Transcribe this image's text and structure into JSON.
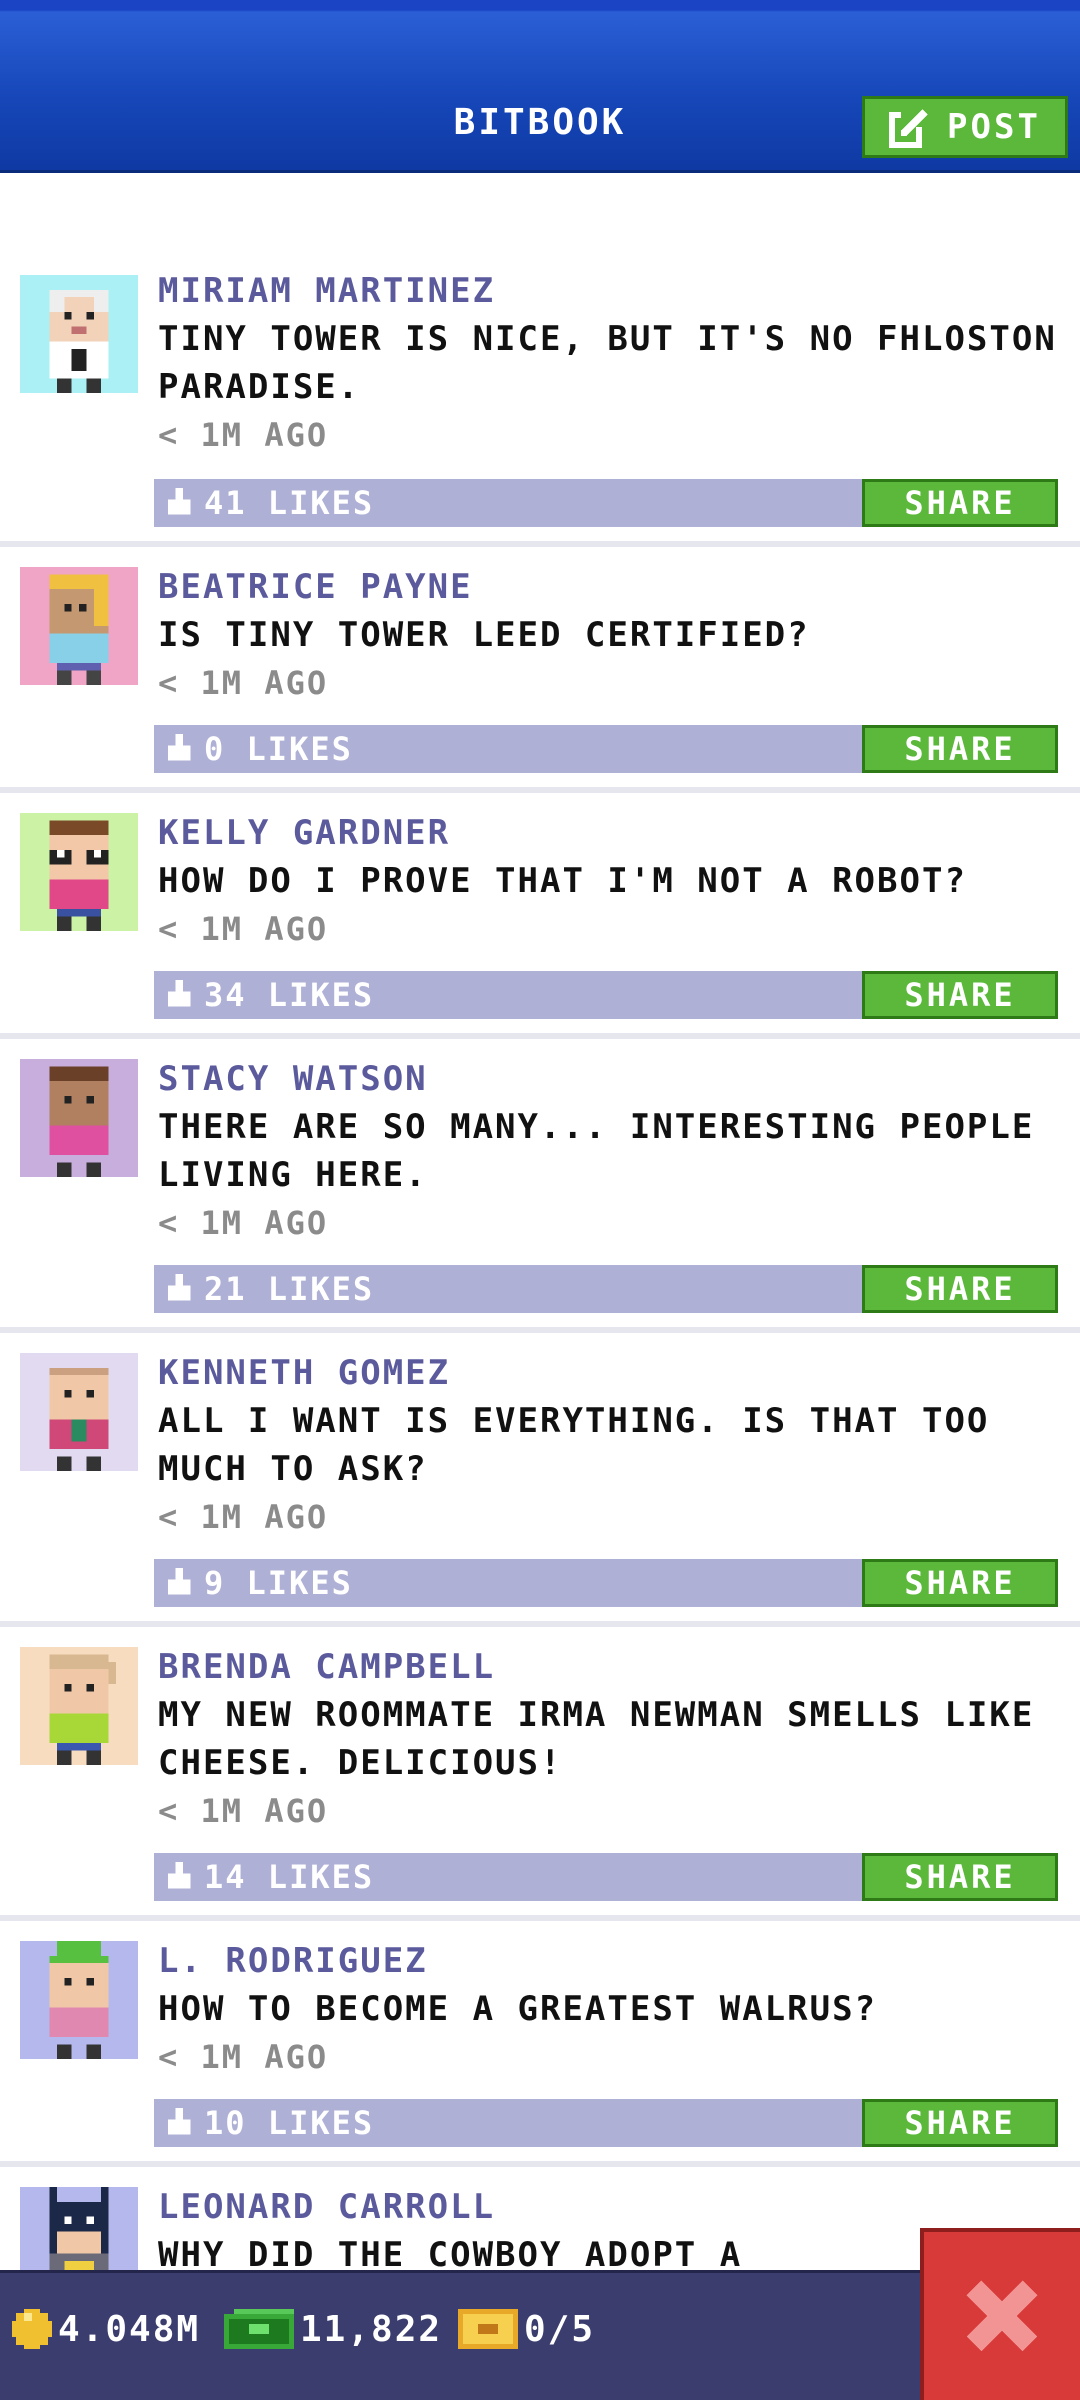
{
  "header": {
    "title": "BITBOOK",
    "post_label": "POST"
  },
  "posts": [
    {
      "author": "MIRIAM MARTINEZ",
      "message": "TINY TOWER IS NICE, BUT IT'S NO FHLOSTON PARADISE.",
      "time": "< 1M AGO",
      "likes": "41 LIKES",
      "share": "SHARE",
      "avatar_bg": "#aaf0f4"
    },
    {
      "author": "BEATRICE PAYNE",
      "message": "IS TINY TOWER LEED CERTIFIED?",
      "time": "< 1M AGO",
      "likes": "0 LIKES",
      "share": "SHARE",
      "avatar_bg": "#f0a4c6"
    },
    {
      "author": "KELLY GARDNER",
      "message": "HOW DO I PROVE THAT I'M NOT A ROBOT?",
      "time": "< 1M AGO",
      "likes": "34 LIKES",
      "share": "SHARE",
      "avatar_bg": "#ccf2a6"
    },
    {
      "author": "STACY WATSON",
      "message": "THERE ARE SO MANY... INTERESTING PEOPLE LIVING HERE.",
      "time": "< 1M AGO",
      "likes": "21 LIKES",
      "share": "SHARE",
      "avatar_bg": "#c8aedc"
    },
    {
      "author": "KENNETH GOMEZ",
      "message": "ALL I WANT IS EVERYTHING. IS THAT TOO MUCH TO ASK?",
      "time": "< 1M AGO",
      "likes": "9 LIKES",
      "share": "SHARE",
      "avatar_bg": "#e2daf0"
    },
    {
      "author": "BRENDA CAMPBELL",
      "message": "MY NEW ROOMMATE IRMA NEWMAN SMELLS LIKE CHEESE. DELICIOUS!",
      "time": "< 1M AGO",
      "likes": "14 LIKES",
      "share": "SHARE",
      "avatar_bg": "#f8dcc0"
    },
    {
      "author": "L. RODRIGUEZ",
      "message": "HOW TO BECOME A GREATEST WALRUS?",
      "time": "< 1M AGO",
      "likes": "10 LIKES",
      "share": "SHARE",
      "avatar_bg": "#b4b8ec"
    },
    {
      "author": "LEONARD CARROLL",
      "message": "WHY DID THE COWBOY ADOPT A",
      "avatar_bg": "#b4b8ec"
    }
  ],
  "bottom_bar": {
    "coins": "4.048M",
    "bux": "11,822",
    "tickets": "0/5"
  },
  "colors": {
    "header_blue": "#1646b8",
    "button_green": "#5cb83a",
    "like_bar": "#afb0d6",
    "author_purple": "#5b5a9c",
    "bottom_bar": "#3b3d6e",
    "close_red": "#d83a3a"
  },
  "icons": [
    "edit-icon",
    "thumb-icon",
    "coin-icon",
    "bux-icon",
    "ticket-icon",
    "close-icon"
  ]
}
